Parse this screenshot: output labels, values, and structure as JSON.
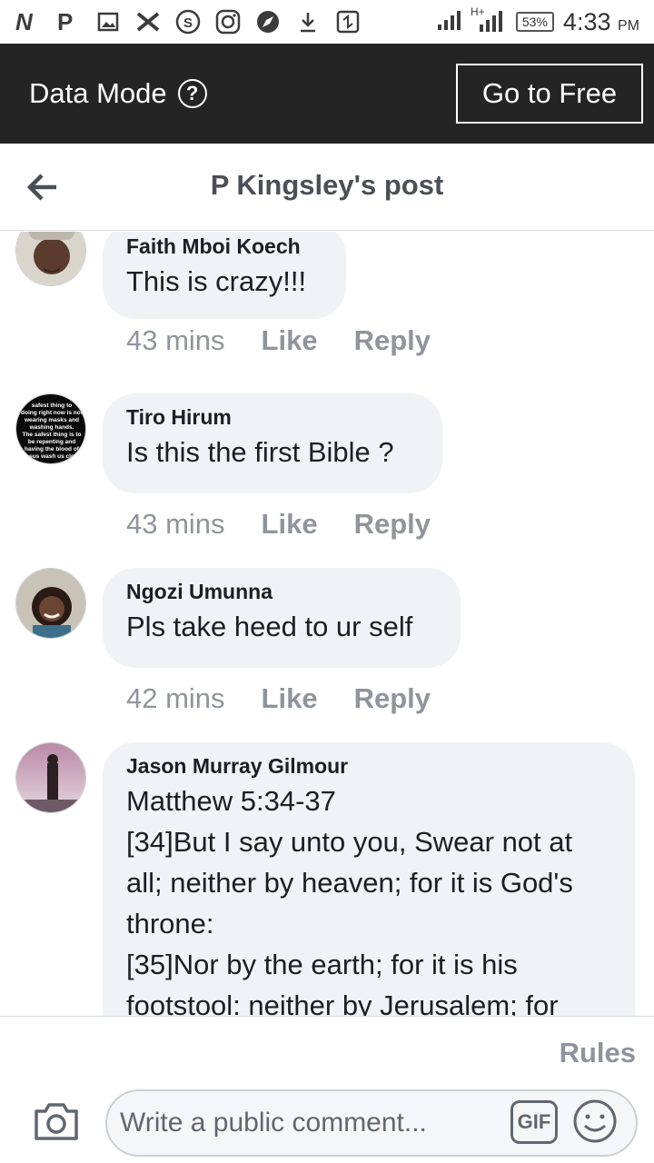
{
  "status_bar": {
    "icons": [
      "n-logo-icon",
      "p-logo-icon",
      "image-icon",
      "x-icon",
      "skype-icon",
      "instagram-icon",
      "compass-icon",
      "download-icon",
      "screen-icon",
      "signal-icon",
      "hplus-signal-icon"
    ],
    "battery": "53%",
    "time": "4:33",
    "ampm": "PM"
  },
  "banner": {
    "label": "Data Mode",
    "help_glyph": "?",
    "button_label": "Go to Free"
  },
  "header": {
    "title": "P Kingsley's post"
  },
  "comments": [
    {
      "name": "Faith Mboi Koech",
      "text": "This is crazy!!!",
      "time": "43 mins",
      "like": "Like",
      "reply": "Reply"
    },
    {
      "name": "Tiro Hirum",
      "text": "Is this the first Bible ?",
      "time": "43 mins",
      "like": "Like",
      "reply": "Reply"
    },
    {
      "name": "Ngozi Umunna",
      "text": "Pls take heed to ur self",
      "time": "42 mins",
      "like": "Like",
      "reply": "Reply"
    },
    {
      "name": "Jason Murray Gilmour",
      "lines": [
        "Matthew 5:34-37",
        "[34]But I say unto you, Swear not at",
        "all; neither by heaven; for it is God's",
        "throne:",
        "[35]Nor by the earth; for it is his",
        "footstool: neither by Jerusalem; for"
      ]
    }
  ],
  "footer": {
    "rules": "Rules",
    "placeholder": "Write a public comment...",
    "gif_label": "GIF"
  },
  "colors": {
    "banner_bg": "#242424",
    "bubble_bg": "#f0f2f5",
    "meta_text": "#90949c"
  }
}
